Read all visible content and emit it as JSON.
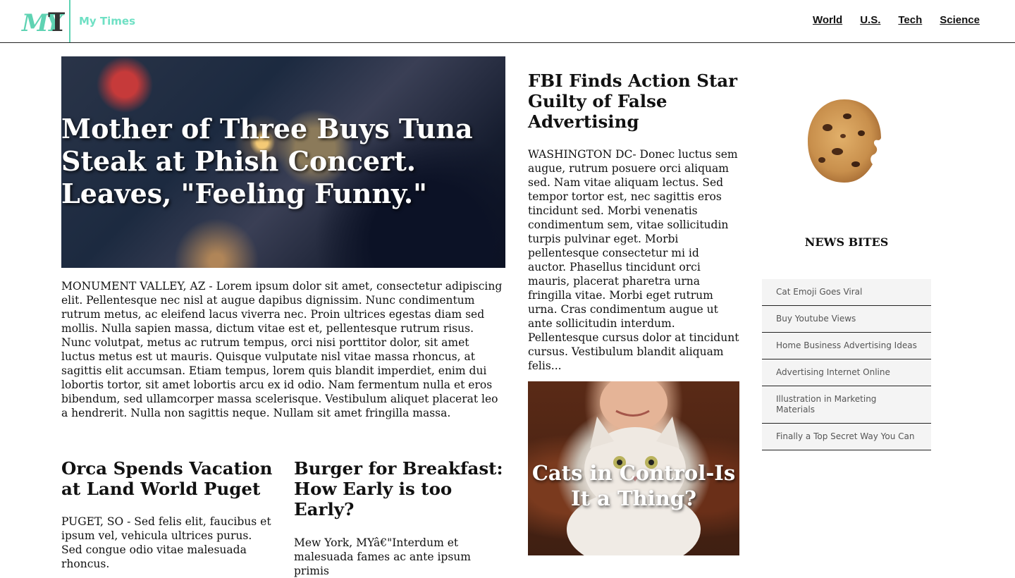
{
  "header": {
    "logo_text": "MYT",
    "brand": "My Times",
    "nav": [
      "World",
      "U.S.",
      "Tech",
      "Science"
    ]
  },
  "lead": {
    "title": "Mother of Three Buys Tuna Steak at Phish Concert. Leaves, \"Feeling Funny.\"",
    "body": "MONUMENT VALLEY, AZ - Lorem ipsum dolor sit amet, consectetur adipiscing elit. Pellentesque nec nisl at augue dapibus dignissim. Nunc condimentum rutrum metus, ac eleifend lacus viverra nec. Proin ultrices egestas diam sed mollis. Nulla sapien massa, dictum vitae est et, pellentesque rutrum risus. Nunc volutpat, metus ac rutrum tempus, orci nisi porttitor dolor, sit amet luctus metus est ut mauris. Quisque vulputate nisl vitae massa rhoncus, at sagittis elit accumsan. Etiam tempus, lorem quis blandit imperdiet, enim dui lobortis tortor, sit amet lobortis arcu ex id odio. Nam fermentum nulla et eros bibendum, sed ullamcorper massa scelerisque. Vestibulum aliquet placerat leo a hendrerit. Nulla non sagittis neque. Nullam sit amet fringilla massa."
  },
  "stories": {
    "orca": {
      "title": "Orca Spends Vacation at Land World Puget",
      "body": "PUGET, SO - Sed felis elit, faucibus et ipsum vel, vehicula ultrices purus. Sed congue odio vitae malesuada rhoncus."
    },
    "burger": {
      "title": "Burger for Breakfast: How Early is too Early?",
      "body": "Mew York, MYâ€\"Interdum et malesuada fames ac ante ipsum primis"
    },
    "fbi": {
      "title": "FBI Finds Action Star Guilty of False Advertising",
      "body": "WASHINGTON DC- Donec luctus sem augue, rutrum posuere orci aliquam sed. Nam vitae aliquam lectus. Sed tempor tortor est, nec sagittis eros tincidunt sed. Morbi venenatis condimentum sem, vitae sollicitudin turpis pulvinar eget. Morbi pellentesque consectetur mi id auctor. Phasellus tincidunt orci mauris, placerat pharetra urna fringilla vitae. Morbi eget rutrum urna. Cras condimentum augue ut ante sollicitudin interdum. Pellentesque cursus dolor at tincidunt cursus. Vestibulum blandit aliquam felis..."
    },
    "cats": {
      "title": "Cats in Control-Is It a Thing?"
    }
  },
  "sidebar": {
    "title": "NEWS BITES",
    "items": [
      "Cat Emoji Goes Viral",
      "Buy Youtube Views",
      "Home Business Advertising Ideas",
      "Advertising Internet Online",
      "Illustration in Marketing Materials",
      "Finally a Top Secret Way You Can"
    ]
  },
  "colors": {
    "brand": "#6fe0c4",
    "text": "#111111",
    "sidebar_bg": "#f4f4f4"
  }
}
